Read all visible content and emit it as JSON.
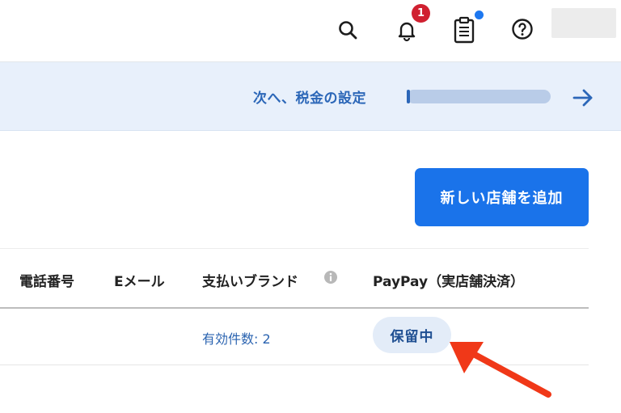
{
  "topbar": {
    "notification_count": "1",
    "icons": [
      "search-icon",
      "bell-icon",
      "clipboard-icon",
      "help-icon"
    ]
  },
  "banner": {
    "next_step_label": "次へ、税金の設定",
    "progress_fraction": 0.02
  },
  "actions": {
    "add_store_label": "新しい店舗を追加"
  },
  "table": {
    "columns": [
      "電話番号",
      "Eメール",
      "支払いブランド",
      "PayPay（実店舗決済）"
    ],
    "rows": [
      {
        "payment_brands": "有効件数: 2",
        "paypay_status": "保留中"
      }
    ]
  },
  "colors": {
    "primary": "#1a73ea",
    "banner_bg": "#e8f0fb",
    "link": "#2a63b0",
    "badge": "#d02030",
    "annotation_arrow": "#f03818"
  }
}
